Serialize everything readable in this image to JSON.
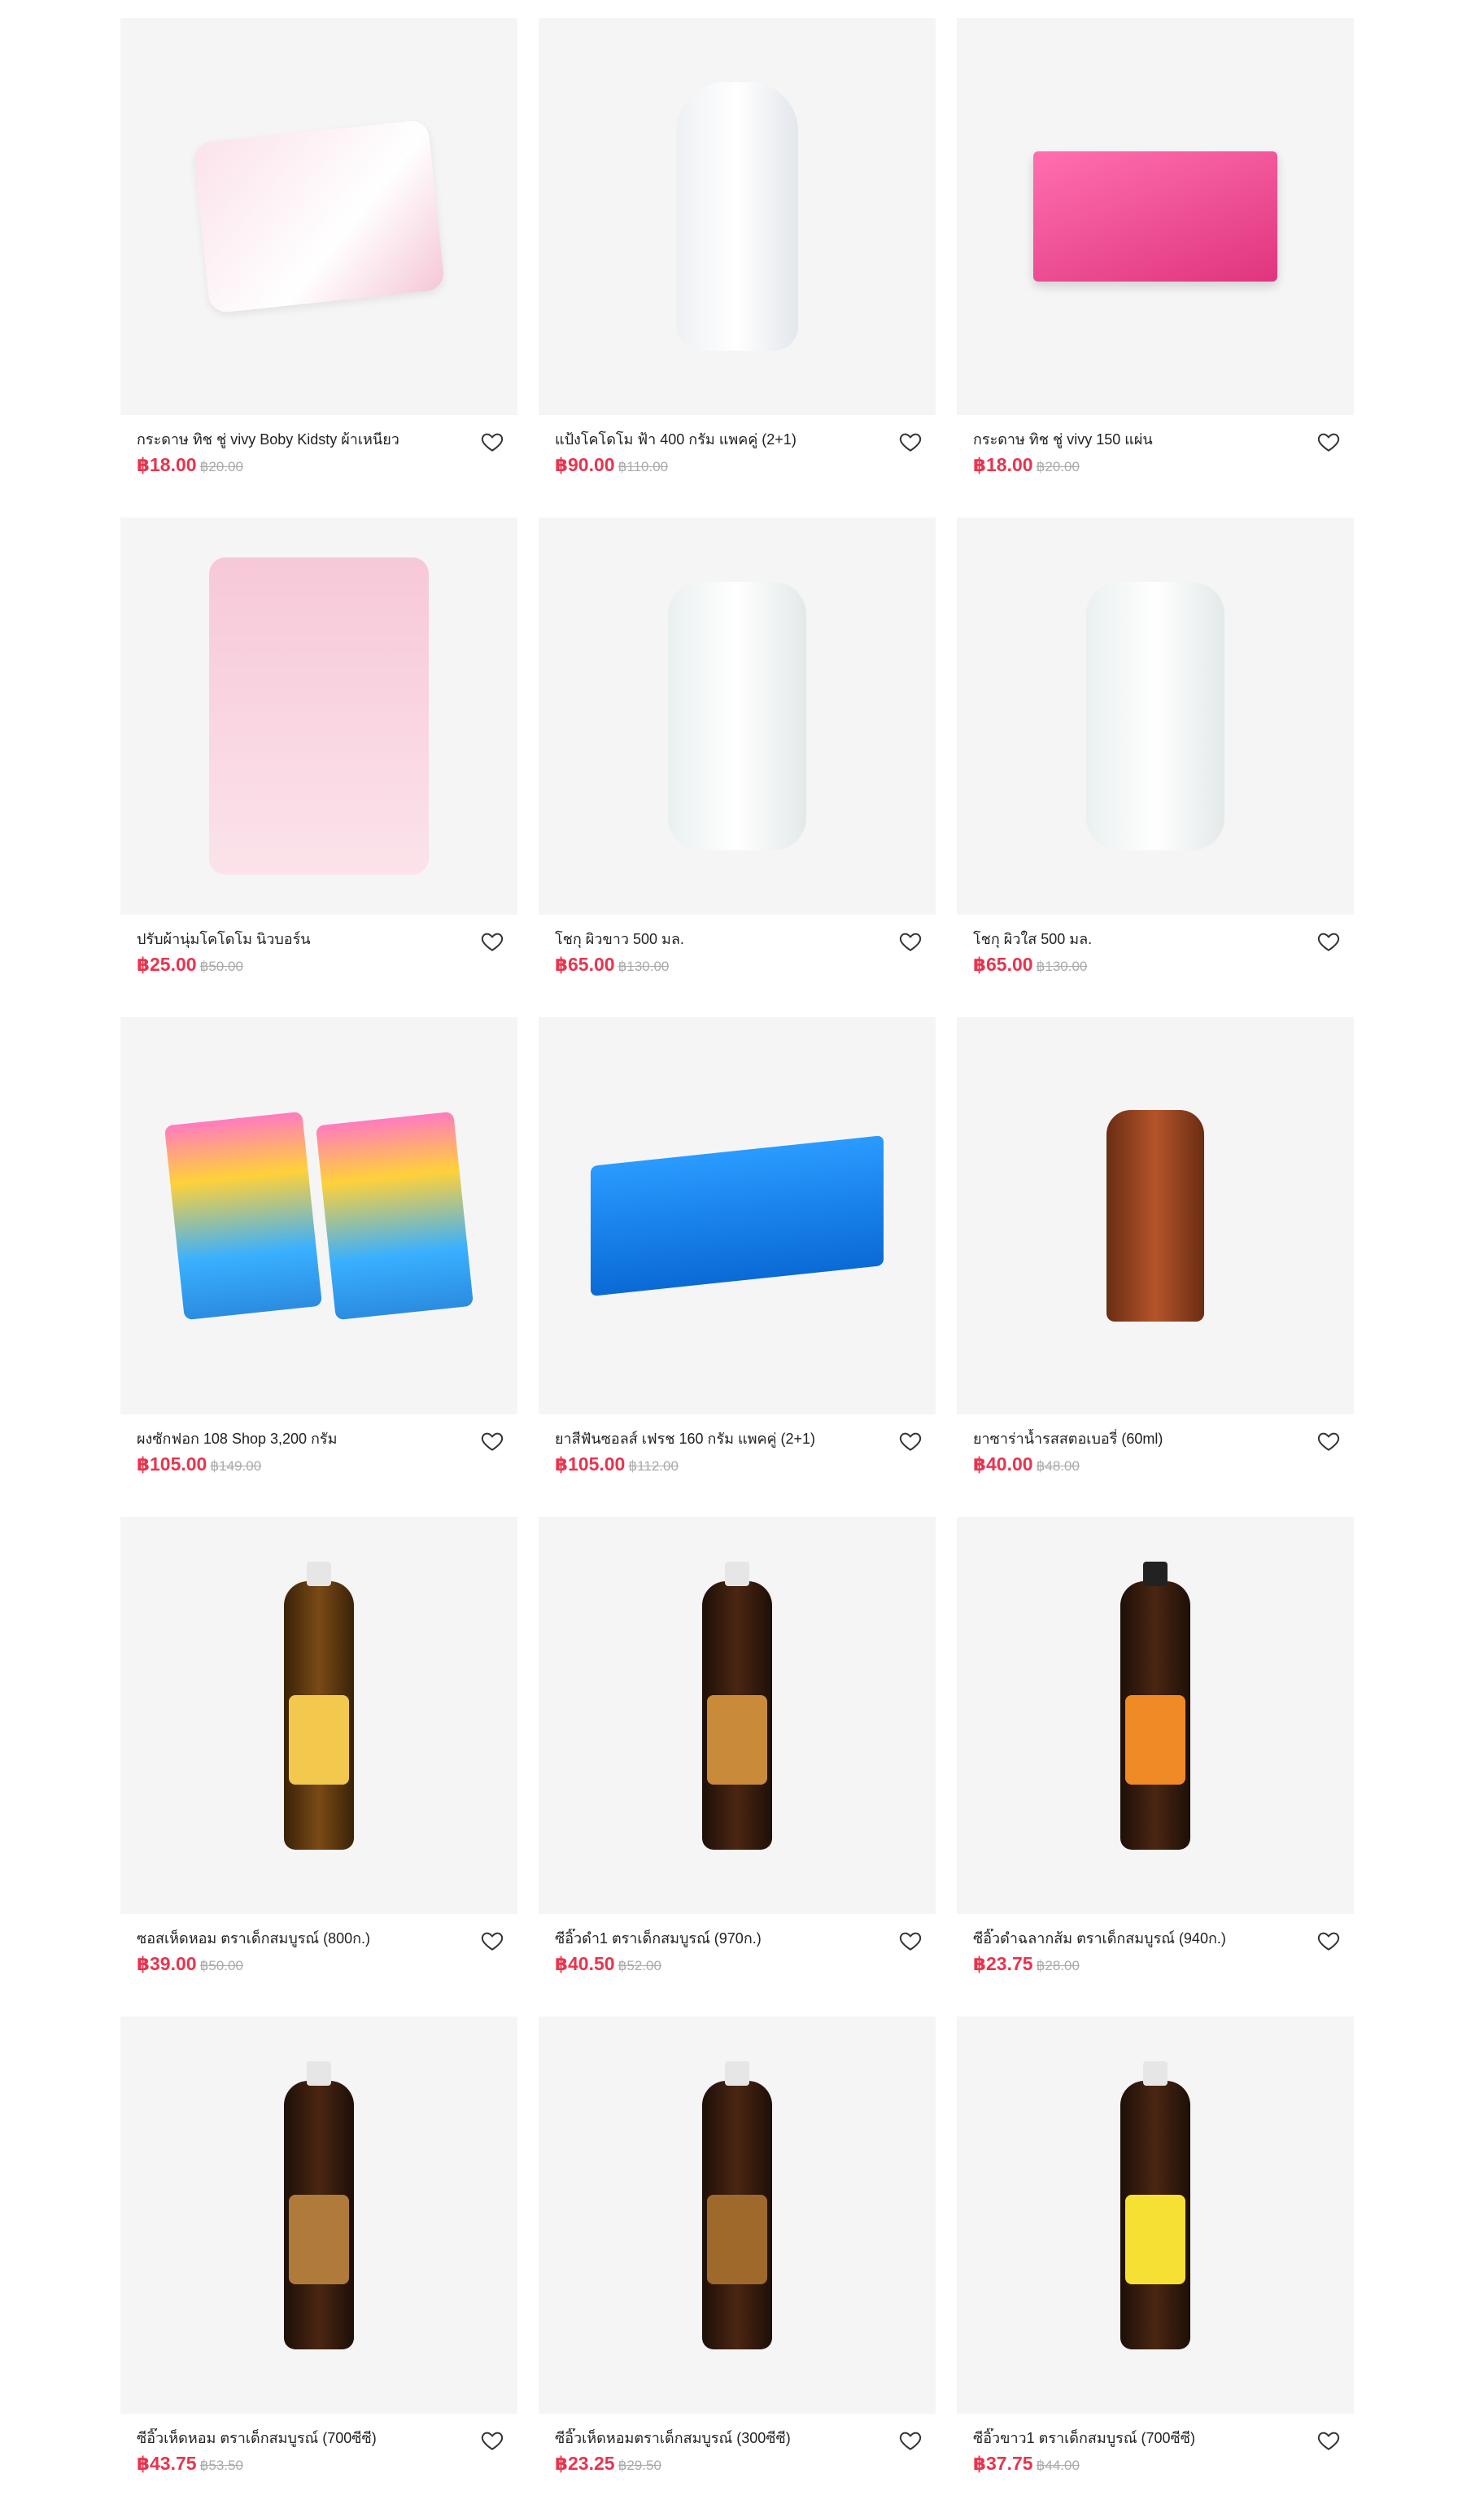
{
  "currency_symbol": "฿",
  "colors": {
    "price": "#e8344e",
    "old_price": "#aaaaaa",
    "thumb_bg": "#f5f5f5"
  },
  "products": [
    {
      "name": "กระดาษ ทิช ชู่ vivy Boby Kidsty ผ้าเหนียว",
      "price": "฿18.00",
      "old_price": "฿20.00",
      "image": "baby-wipes-pack"
    },
    {
      "name": "แป้งโคโดโม ฟ้า 400 กรัม แพคคู่ (2+1)",
      "price": "฿90.00",
      "old_price": "฿110.00",
      "image": "baby-powder-bottle"
    },
    {
      "name": "กระดาษ ทิช ชู่ vivy 150 แผ่น",
      "price": "฿18.00",
      "old_price": "฿20.00",
      "image": "tissue-box"
    },
    {
      "name": "ปรับผ้านุ่มโคโดโม นิวบอร์น",
      "price": "฿25.00",
      "old_price": "฿50.00",
      "image": "fabric-softener-pouch"
    },
    {
      "name": "โชกุ ผิวขาว 500 มล.",
      "price": "฿65.00",
      "old_price": "฿130.00",
      "image": "shower-cream-green"
    },
    {
      "name": "โชกุ ผิวใส 500 มล.",
      "price": "฿65.00",
      "old_price": "฿130.00",
      "image": "shower-cream-orange"
    },
    {
      "name": "ผงซักฟอก 108 Shop 3,200 กรัม",
      "price": "฿105.00",
      "old_price": "฿149.00",
      "image": "detergent-bags"
    },
    {
      "name": "ยาสีฟันซอลส์ เฟรช 160 กรัม แพคคู่ (2+1)",
      "price": "฿105.00",
      "old_price": "฿112.00",
      "image": "toothpaste-pack"
    },
    {
      "name": "ยาซาร่าน้ำรสสตอเบอรี่ (60ml)",
      "price": "฿40.00",
      "old_price": "฿48.00",
      "image": "syrup-bottle"
    },
    {
      "name": "ซอสเห็ดหอม ตราเด็กสมบูรณ์ (800ก.)",
      "price": "฿39.00",
      "old_price": "฿50.00",
      "image": "sauce-bottle"
    },
    {
      "name": "ซีอิ๊วดำ1 ตราเด็กสมบูรณ์ (970ก.)",
      "price": "฿40.50",
      "old_price": "฿52.00",
      "image": "sauce-bottle"
    },
    {
      "name": "ซีอิ๊วดำฉลากส้ม ตราเด็กสมบูรณ์ (940ก.)",
      "price": "฿23.75",
      "old_price": "฿28.00",
      "image": "sauce-bottle"
    },
    {
      "name": "ซีอิ๊วเห็ดหอม ตราเด็กสมบูรณ์ (700ซีซี)",
      "price": "฿43.75",
      "old_price": "฿53.50",
      "image": "sauce-bottle"
    },
    {
      "name": "ซีอิ๊วเห็ดหอมตราเด็กสมบูรณ์ (300ซีซี)",
      "price": "฿23.25",
      "old_price": "฿29.50",
      "image": "sauce-bottle"
    },
    {
      "name": "ซีอิ๊วขาว1 ตราเด็กสมบูรณ์ (700ซีซี)",
      "price": "฿37.75",
      "old_price": "฿44.00",
      "image": "sauce-bottle"
    }
  ]
}
